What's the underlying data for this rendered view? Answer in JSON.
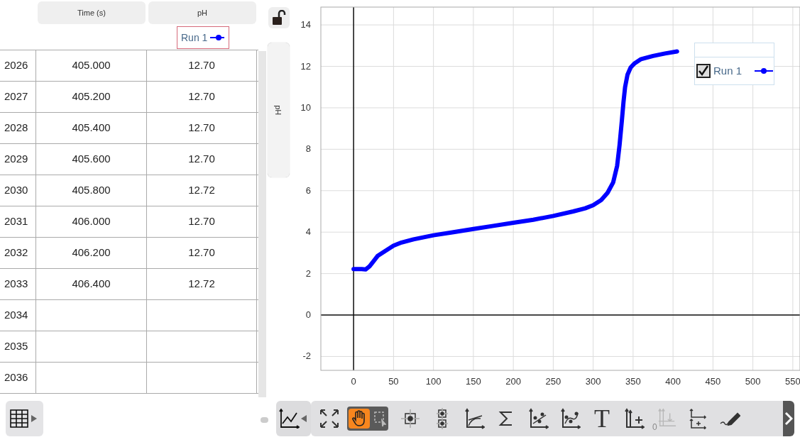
{
  "table": {
    "columns": [
      "Time (s)",
      "pH"
    ],
    "run_legend": "Run 1",
    "rows": [
      {
        "index": "2026",
        "time": "405.000",
        "ph": "12.70"
      },
      {
        "index": "2027",
        "time": "405.200",
        "ph": "12.70"
      },
      {
        "index": "2028",
        "time": "405.400",
        "ph": "12.70"
      },
      {
        "index": "2029",
        "time": "405.600",
        "ph": "12.70"
      },
      {
        "index": "2030",
        "time": "405.800",
        "ph": "12.72"
      },
      {
        "index": "2031",
        "time": "406.000",
        "ph": "12.70"
      },
      {
        "index": "2032",
        "time": "406.200",
        "ph": "12.70"
      },
      {
        "index": "2033",
        "time": "406.400",
        "ph": "12.72"
      },
      {
        "index": "2034",
        "time": "",
        "ph": ""
      },
      {
        "index": "2035",
        "time": "",
        "ph": ""
      },
      {
        "index": "2036",
        "time": "",
        "ph": ""
      }
    ]
  },
  "axis_button": {
    "label": "pH"
  },
  "graph": {
    "legend": {
      "checked": true
    },
    "chart_data": {
      "type": "line",
      "grid": true,
      "x": [
        0,
        10,
        15,
        20,
        25,
        30,
        40,
        50,
        60,
        75,
        100,
        125,
        150,
        175,
        200,
        225,
        250,
        275,
        290,
        300,
        310,
        318,
        325,
        330,
        333,
        336,
        338,
        340,
        343,
        347,
        352,
        360,
        375,
        390,
        405
      ],
      "series": [
        {
          "name": "Run 1",
          "color": "#0000ff",
          "values": [
            2.22,
            2.22,
            2.2,
            2.35,
            2.6,
            2.85,
            3.1,
            3.35,
            3.5,
            3.65,
            3.85,
            4.0,
            4.15,
            4.3,
            4.45,
            4.6,
            4.78,
            5.0,
            5.15,
            5.3,
            5.55,
            5.9,
            6.4,
            7.2,
            8.2,
            9.4,
            10.3,
            11.0,
            11.6,
            11.95,
            12.15,
            12.35,
            12.5,
            12.62,
            12.72
          ]
        }
      ],
      "xlim": [
        -41,
        559
      ],
      "ylim": [
        -2.67,
        14.86
      ],
      "xticks": [
        0,
        50,
        100,
        150,
        200,
        250,
        300,
        350,
        400,
        450,
        500,
        550
      ],
      "yticks": [
        -2,
        0,
        2,
        4,
        6,
        8,
        10,
        12,
        14
      ]
    }
  },
  "toolbar": {
    "tools": [
      {
        "kind": "autoscale",
        "selected": false,
        "disabled": false
      },
      {
        "kind": "pan",
        "selected": true,
        "disabled": false
      },
      {
        "kind": "select",
        "selected": false,
        "disabled": false
      },
      {
        "kind": "examine",
        "selected": false,
        "disabled": false
      },
      {
        "kind": "interpolate",
        "selected": false,
        "disabled": false
      },
      {
        "kind": "tangent",
        "selected": false,
        "disabled": false
      },
      {
        "kind": "statistics",
        "selected": false,
        "disabled": false
      },
      {
        "kind": "linear-fit",
        "selected": false,
        "disabled": false
      },
      {
        "kind": "curve-fit",
        "selected": false,
        "disabled": false
      },
      {
        "kind": "text",
        "glyph": "T",
        "selected": false,
        "disabled": false
      },
      {
        "kind": "add-axis",
        "selected": false,
        "disabled": false
      },
      {
        "kind": "axis-offset",
        "glyph": "0",
        "selected": false,
        "disabled": true
      },
      {
        "kind": "add-graph",
        "selected": false,
        "disabled": false
      },
      {
        "kind": "draw",
        "selected": false,
        "disabled": false
      }
    ]
  }
}
